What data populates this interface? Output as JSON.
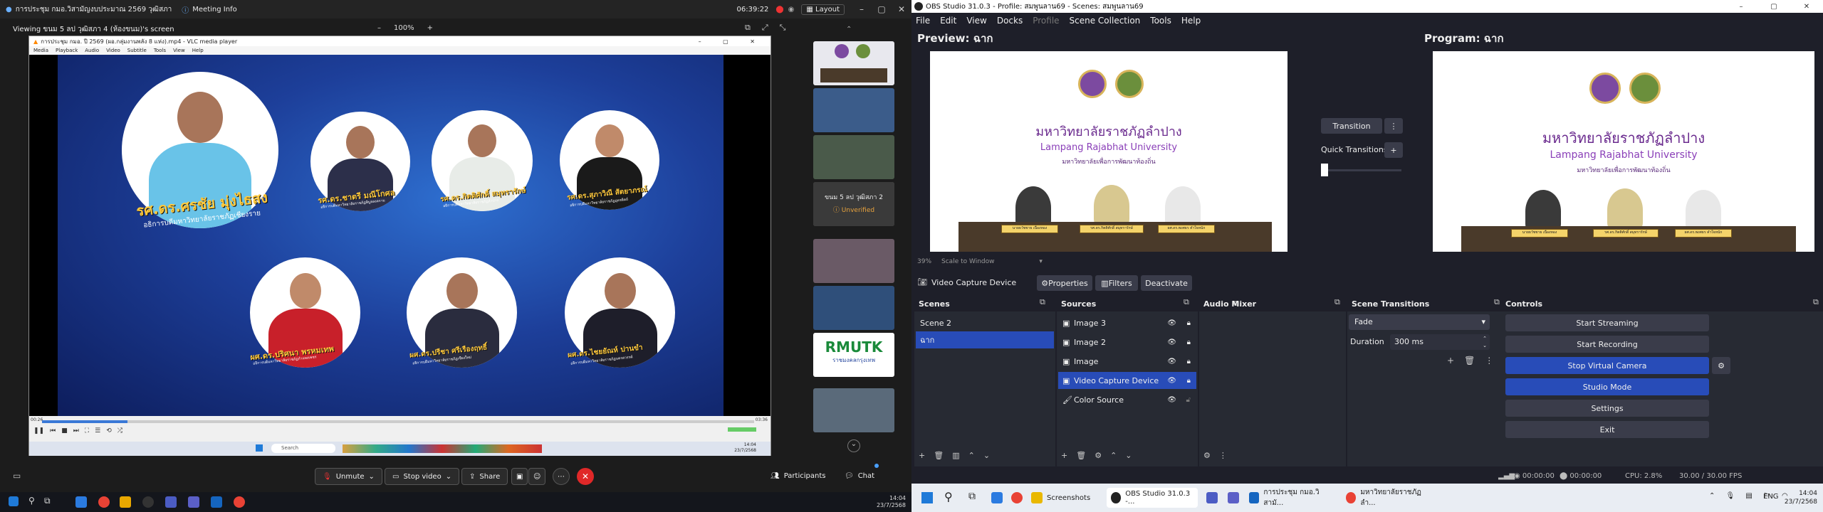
{
  "zoom": {
    "titlebar": {
      "app_title": "การประชุม กมอ.วิสามัญงบประมาณ 2569 วุฒิสภา",
      "meeting_info": "Meeting Info",
      "time": "06:39:22",
      "layout": "Layout"
    },
    "viewing": "Viewing ขนม 5 ลป วุฒิสภา 4 (ห้องขนม)'s screen",
    "zoom_level": "100%",
    "vlc": {
      "title": "การประชุม กมอ. ปี 2569 (ผอ.กลุ่มงานพลัง 8 แห่ง).mp4 - VLC media player",
      "menu": [
        "Media",
        "Playback",
        "Audio",
        "Video",
        "Subtitle",
        "Tools",
        "View",
        "Help"
      ],
      "time_start": "00:26",
      "time_end": "03:36",
      "progress": 0.12
    },
    "slide": {
      "people": [
        {
          "name": "รศ.ดร.ศรชัย มุ่งไธสง",
          "title": "อธิการบดีมหาวิทยาลัยราชภัฏเชียงราย"
        },
        {
          "name": "รศ.ดร.ชาตรี มณีโกศล",
          "title": "อธิการบดีมหาวิทยาลัยราชภัฏพิบูลสงคราม"
        },
        {
          "name": "รศ.ดร.กิตติศักดิ์ สมุทรารักษ์",
          "title": "อธิการบดีมหาวิทยาลัยราชภัฏลำปาง"
        },
        {
          "name": "รศ.ดร.สุภาวิณี สัตยาภรณ์",
          "title": "อธิการบดีมหาวิทยาลัยราชภัฏอุตรดิตถ์"
        },
        {
          "name": "ผศ.ดร.ปริศนา พรหมเทพ",
          "title": "อธิการบดีมหาวิทยาลัยราชภัฏกำแพงเพชร"
        },
        {
          "name": "ผศ.ดร.ปรีชา ศรีเรืองฤทธิ์",
          "title": "อธิการบดีมหาวิทยาลัยราชภัฏเชียงใหม่"
        },
        {
          "name": "ผศ.ดร.ไชยยัณห์ ปานขำ",
          "title": "อธิการบดีมหาวิทยาลัยราชภัฏนครสวรรค์"
        }
      ]
    },
    "inner_taskbar": {
      "search": "Search",
      "time": "14:04",
      "date": "23/7/2568"
    },
    "gallery": {
      "unverified_name": "ขนม 5 ลป วุฒิสภา 2",
      "unverified_label": "Unverified",
      "logo_text": "RMUTK",
      "logo_sub": "ราชมงคลกรุงเทพ"
    },
    "toolbar": {
      "unmute": "Unmute",
      "stop_video": "Stop video",
      "share": "Share",
      "participants": "Participants",
      "chat": "Chat"
    },
    "taskbar": {
      "time": "14:04",
      "date": "23/7/2568"
    }
  },
  "obs": {
    "title": "OBS Studio 31.0.3 - Profile: สมพูนลาน69 - Scenes: สมพูนลาน69",
    "menu": [
      "File",
      "Edit",
      "View",
      "Docks",
      "Profile",
      "Scene Collection",
      "Tools",
      "Help"
    ],
    "preview_label": "Preview: ฉาก",
    "program_label": "Program: ฉาก",
    "canvas": {
      "thai": "มหาวิทยาลัยราชภัฏลำปาง",
      "eng": "Lampang Rajabhat University",
      "sub": "มหาวิทยาลัยเพื่อการพัฒนาท้องถิ่น",
      "plates": [
        "นายธวัชชาย เนื่องทอง",
        "รศ.ดร.กิตติศักดิ์ สมุทรารักษ์",
        "ผศ.ดร.พงศธร คำใจหนัก"
      ]
    },
    "scale": "39%",
    "scale_mode": "Scale to Window",
    "transition": "Transition",
    "quick_transitions": "Quick Transitions",
    "source_bar": {
      "name": "Video Capture Device",
      "properties": "Properties",
      "filters": "Filters",
      "deactivate": "Deactivate"
    },
    "docks": {
      "scenes": "Scenes",
      "sources": "Sources",
      "audio": "Audio Mixer",
      "transitions": "Scene Transitions",
      "controls": "Controls"
    },
    "scenes": [
      "Scene 2",
      "ฉาก"
    ],
    "sources": [
      "Image 3",
      "Image 2",
      "Image",
      "Video Capture Device",
      "Color Source"
    ],
    "scene_transitions": {
      "type": "Fade",
      "duration_label": "Duration",
      "duration": "300 ms"
    },
    "controls": [
      "Start Streaming",
      "Start Recording",
      "Stop Virtual Camera",
      "Studio Mode",
      "Settings",
      "Exit"
    ],
    "status": {
      "stream_time": "00:00:00",
      "rec_time": "00:00:00",
      "cpu": "CPU: 2.8%",
      "fps": "30.00 / 30.00 FPS"
    },
    "taskbar": {
      "screenshots": "Screenshots",
      "obs": "OBS Studio 31.0.3 -...",
      "meeting": "การประชุม กมอ.วิสามั...",
      "chrome": "มหาวิทยาลัยราชภัฏลำ...",
      "lang": "ENG",
      "time": "14:04",
      "date": "23/7/2568"
    }
  }
}
